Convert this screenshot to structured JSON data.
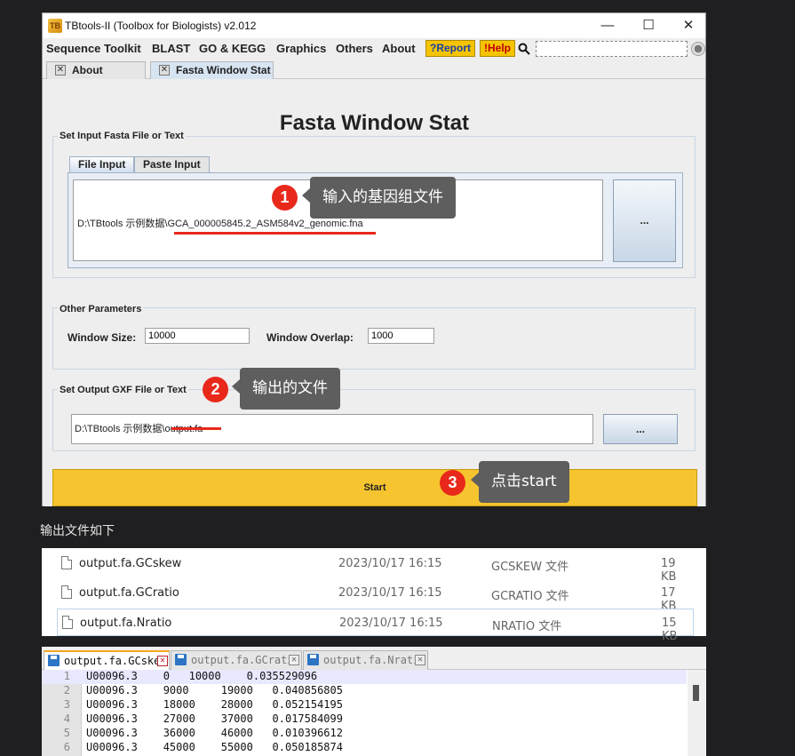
{
  "window": {
    "title": "TBtools-II (Toolbox for Biologists) v2.012",
    "icon_text": "TB",
    "controls": {
      "minimize": "—",
      "maximize": "☐",
      "close": "✕"
    }
  },
  "menu": {
    "items": [
      "Sequence Toolkit",
      "BLAST",
      "GO & KEGG",
      "Graphics",
      "Others",
      "About"
    ],
    "report": "?Report",
    "help": "!Help",
    "search_placeholder": ""
  },
  "doc_tabs": [
    {
      "label": "About TBtools",
      "close": "✕"
    },
    {
      "label": "Fasta Window Stat",
      "close": "✕"
    }
  ],
  "form": {
    "heading": "Fasta Window Stat",
    "input_group": {
      "label": "Set Input Fasta File or Text",
      "tabs": [
        "File Input",
        "Paste Input"
      ],
      "file_path": "D:\\TBtools 示例数据\\GCA_000005845.2_ASM584v2_genomic.fna",
      "browse": "..."
    },
    "params_group": {
      "label": "Other Parameters",
      "window_size_label": "Window Size:",
      "window_size": "10000",
      "window_overlap_label": "Window Overlap:",
      "window_overlap": "1000"
    },
    "output_group": {
      "label": "Set Output GXF File or Text",
      "file_path": "D:\\TBtools 示例数据\\output.fa",
      "browse": "..."
    },
    "start": "Start"
  },
  "annotations": [
    {
      "num": "1",
      "text": "输入的基因组文件"
    },
    {
      "num": "2",
      "text": "输出的文件"
    },
    {
      "num": "3",
      "text": "点击start"
    }
  ],
  "caption": "输出文件如下",
  "files": [
    {
      "name": "output.fa.GCskew",
      "date": "2023/10/17 16:15",
      "type": "GCSKEW 文件",
      "size": "19 KB"
    },
    {
      "name": "output.fa.GCratio",
      "date": "2023/10/17 16:15",
      "type": "GCRATIO 文件",
      "size": "17 KB"
    },
    {
      "name": "output.fa.Nratio",
      "date": "2023/10/17 16:15",
      "type": "NRATIO 文件",
      "size": "15 KB"
    }
  ],
  "editor": {
    "tabs": [
      "output.fa.GCskew",
      "output.fa.GCratio",
      "output.fa.Nratio"
    ],
    "lines": [
      {
        "n": "1",
        "text": "U00096.3    0   10000    0.035529096"
      },
      {
        "n": "2",
        "text": "U00096.3    9000     19000   0.040856805"
      },
      {
        "n": "3",
        "text": "U00096.3    18000    28000   0.052154195"
      },
      {
        "n": "4",
        "text": "U00096.3    27000    37000   0.017584099"
      },
      {
        "n": "5",
        "text": "U00096.3    36000    46000   0.010396612"
      },
      {
        "n": "6",
        "text": "U00096.3    45000    55000   0.050185874"
      }
    ]
  }
}
